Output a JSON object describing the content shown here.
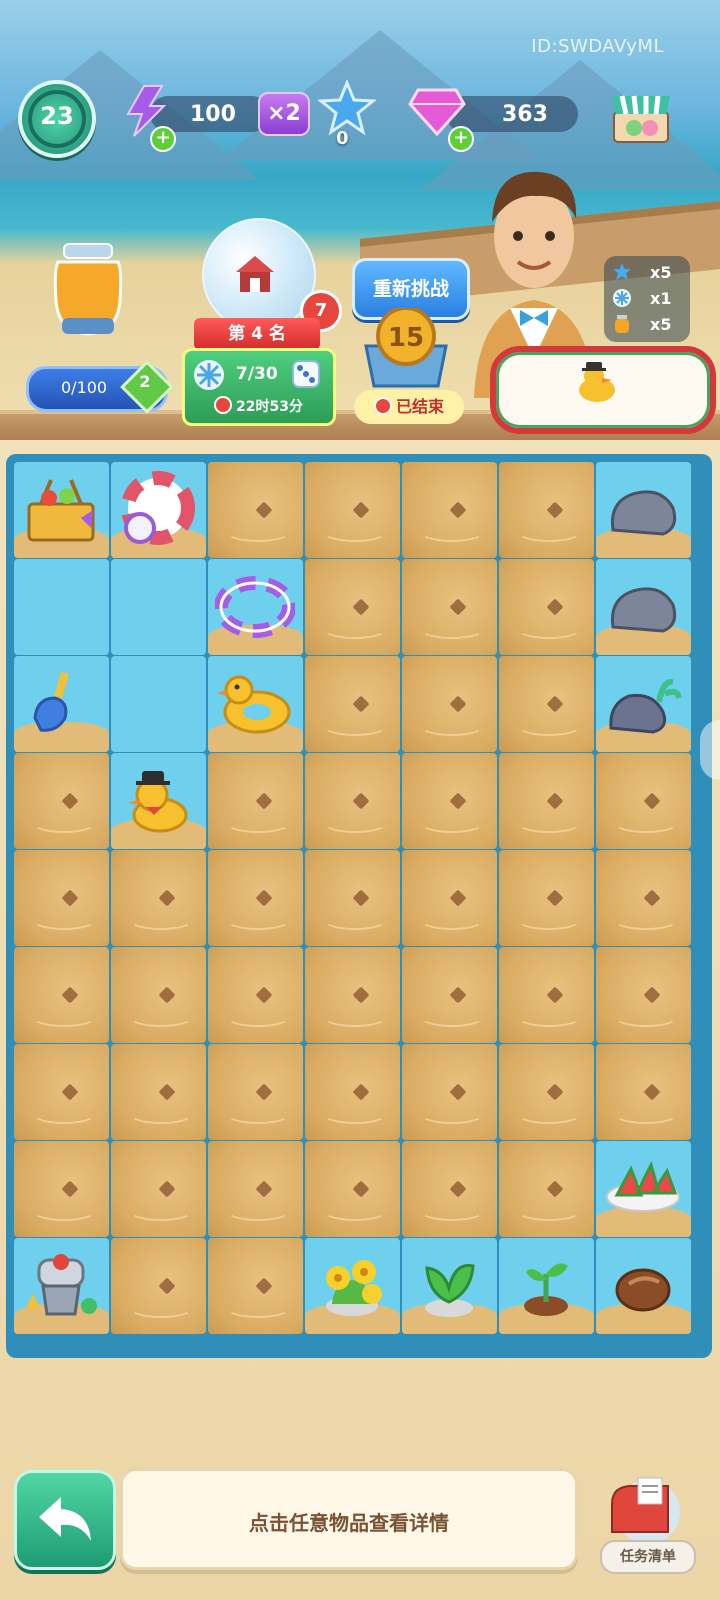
{
  "hud": {
    "id_text": "ID:SWDAVyML",
    "level": "23",
    "energy": "100",
    "multiplier": "×2",
    "stars": "0",
    "gems": "363"
  },
  "honey": {
    "progress": "0/100",
    "badge": "2"
  },
  "event": {
    "notification_count": "7",
    "rank": "第 4 名",
    "count": "7/30",
    "timer": "22时53分"
  },
  "challenge": {
    "button": "重新挑战",
    "coin_value": "15",
    "status": "已结束"
  },
  "rewards": [
    {
      "icon": "star-icon",
      "qty": "x5"
    },
    {
      "icon": "snowflake-icon",
      "qty": "x1"
    },
    {
      "icon": "jar-icon",
      "qty": "x5"
    }
  ],
  "order": {
    "item": "rubber-duck-hat"
  },
  "board": {
    "cols": 7,
    "rows": 9,
    "cells": [
      [
        "picnic-basket",
        "swim-ring-striped",
        "sand",
        "sand",
        "sand",
        "sand",
        "rock"
      ],
      [
        "empty",
        "empty",
        "swim-ring-purple",
        "sand",
        "sand",
        "sand",
        "rock"
      ],
      [
        "shovel",
        "empty",
        "duck-float",
        "sand",
        "sand",
        "sand",
        "rock-plant"
      ],
      [
        "sand",
        "duck-hat",
        "sand",
        "sand",
        "sand",
        "sand",
        "sand"
      ],
      [
        "sand",
        "sand",
        "sand",
        "sand",
        "sand",
        "sand",
        "sand"
      ],
      [
        "sand",
        "sand",
        "sand",
        "sand",
        "sand",
        "sand",
        "sand"
      ],
      [
        "sand",
        "sand",
        "sand",
        "sand",
        "sand",
        "sand",
        "sand"
      ],
      [
        "sand",
        "sand",
        "sand",
        "sand",
        "sand",
        "sand",
        "watermelon"
      ],
      [
        "juicer",
        "sand",
        "sand",
        "yellow-flowers",
        "green-plant",
        "sprout",
        "seed"
      ]
    ]
  },
  "footer": {
    "hint": "点击任意物品查看详情",
    "task_label": "任务清单"
  },
  "colors": {
    "board_bg": "#2f8fb8",
    "open_cell": "#6fd0ee",
    "sand": "#d9ab62",
    "accent_green": "#1e9c74",
    "event_red": "#d22a2a"
  }
}
